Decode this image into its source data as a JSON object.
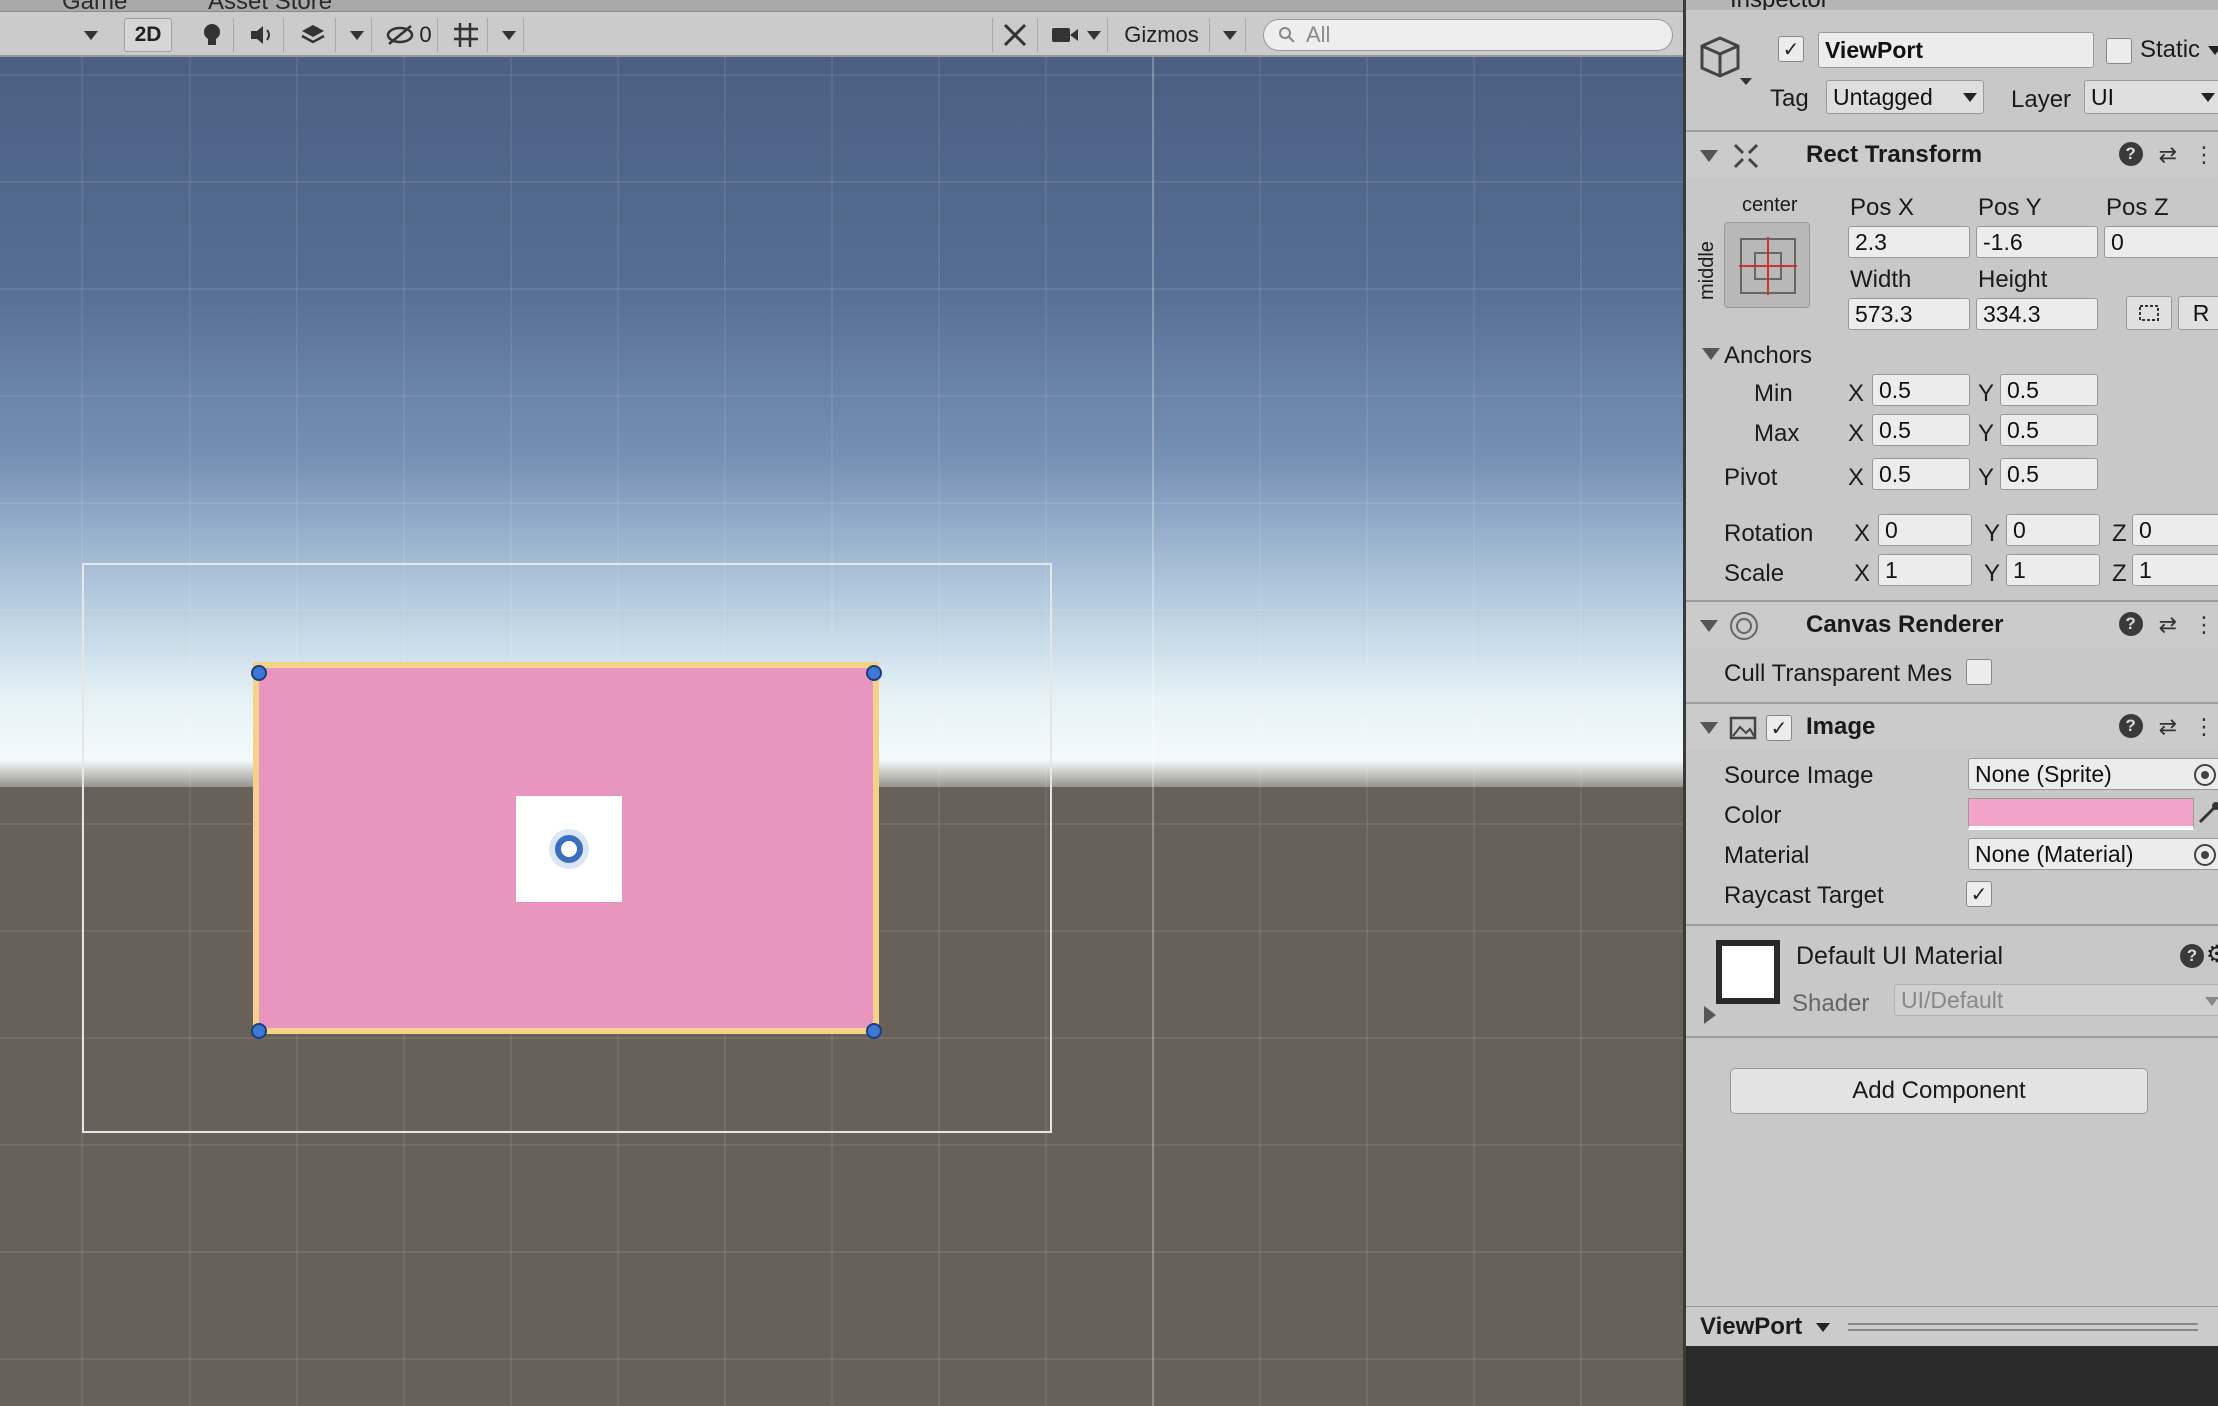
{
  "scene": {
    "tabs": [
      "Game",
      "Asset Store"
    ],
    "toolbar": {
      "mode_2d": "2D",
      "hidden_count": "0",
      "gizmos": "Gizmos",
      "search_placeholder": "All"
    }
  },
  "inspector": {
    "tab_title": "Inspector",
    "object_name": "ViewPort",
    "static_label": "Static",
    "tag_label": "Tag",
    "tag_value": "Untagged",
    "layer_label": "Layer",
    "layer_value": "UI",
    "rect_transform": {
      "title": "Rect Transform",
      "anchor_preset_h": "center",
      "anchor_preset_v": "middle",
      "pos_x_label": "Pos X",
      "pos_x": "2.3",
      "pos_y_label": "Pos Y",
      "pos_y": "-1.6",
      "pos_z_label": "Pos Z",
      "pos_z": "0",
      "width_label": "Width",
      "width": "573.3",
      "height_label": "Height",
      "height": "334.3",
      "raw_button": "R",
      "anchors_label": "Anchors",
      "min_label": "Min",
      "min_x": "0.5",
      "min_y": "0.5",
      "max_label": "Max",
      "max_x": "0.5",
      "max_y": "0.5",
      "pivot_label": "Pivot",
      "pivot_x": "0.5",
      "pivot_y": "0.5",
      "rotation_label": "Rotation",
      "rot_x": "0",
      "rot_y": "0",
      "rot_z": "0",
      "scale_label": "Scale",
      "scale_x": "1",
      "scale_y": "1",
      "scale_z": "1",
      "axis_x": "X",
      "axis_y": "Y",
      "axis_z": "Z"
    },
    "canvas_renderer": {
      "title": "Canvas Renderer",
      "cull_label": "Cull Transparent Mes"
    },
    "image": {
      "title": "Image",
      "source_label": "Source Image",
      "source_value": "None (Sprite)",
      "color_label": "Color",
      "color_value": "#f1a3c9",
      "material_label": "Material",
      "material_value": "None (Material)",
      "raycast_label": "Raycast Target"
    },
    "material_preview": {
      "name": "Default UI Material",
      "shader_label": "Shader",
      "shader_value": "UI/Default"
    },
    "add_component": "Add Component",
    "footer_label": "ViewPort"
  }
}
